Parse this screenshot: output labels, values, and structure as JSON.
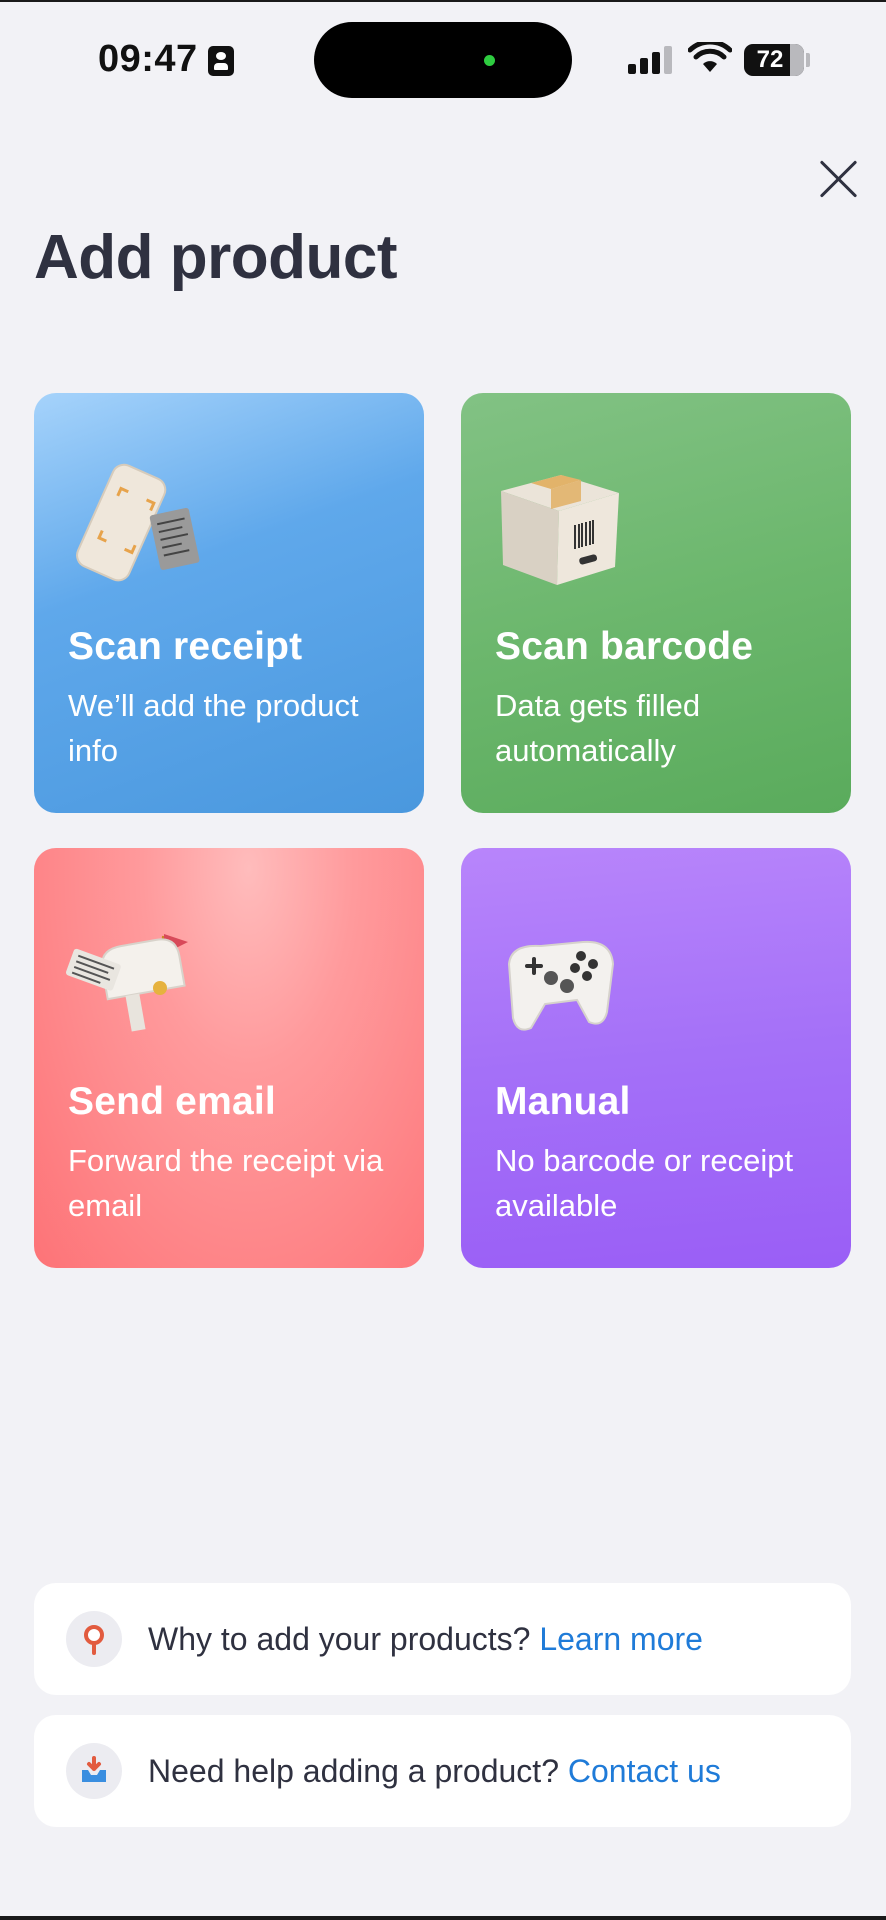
{
  "status_bar": {
    "time": "09:47",
    "battery": "72",
    "icons": [
      "id-card-icon",
      "signal-icon",
      "wifi-icon",
      "battery-icon"
    ]
  },
  "header": {
    "title": "Add product",
    "close_icon": "close-icon"
  },
  "cards": [
    {
      "id": "scan-receipt",
      "title": "Scan receipt",
      "description": "We’ll add the product info",
      "icon": "phone-receipt-icon"
    },
    {
      "id": "scan-barcode",
      "title": "Scan barcode",
      "description": "Data gets filled automatically",
      "icon": "barcode-box-icon"
    },
    {
      "id": "send-email",
      "title": "Send email",
      "description": "Forward the receipt via email",
      "icon": "mailbox-icon"
    },
    {
      "id": "manual",
      "title": "Manual",
      "description": "No barcode or receipt available",
      "icon": "gamepad-icon"
    }
  ],
  "info": [
    {
      "text": "Why to add your products?",
      "link": "Learn more",
      "icon": "magnifier-icon"
    },
    {
      "text": "Need help adding a product?",
      "link": "Contact us",
      "icon": "inbox-icon"
    }
  ],
  "colors": {
    "background": "#f2f2f6",
    "receipt_card": "#4a98de",
    "barcode_card": "#6cb76d",
    "email_card": "#fd7377",
    "manual_card": "#a470f8",
    "link": "#1f7bd8"
  }
}
